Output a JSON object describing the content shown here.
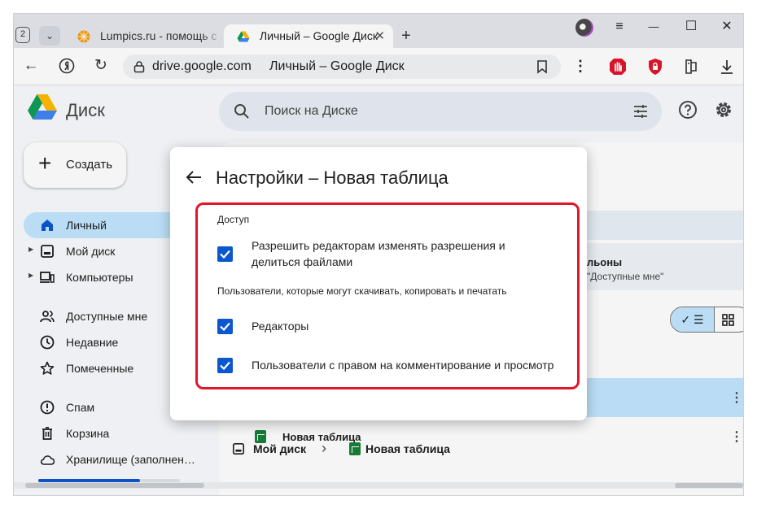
{
  "browser": {
    "tab_count": "2",
    "tabs": [
      {
        "label": "Lumpics.ru - помощь с ко",
        "active": false
      },
      {
        "label": "Личный – Google Диск",
        "active": true
      }
    ],
    "new_tab": "+",
    "window_controls": {
      "menu": "≡",
      "minimize": "—",
      "maximize": "☐",
      "close": "✕"
    },
    "address": {
      "domain": "drive.google.com",
      "title": "Личный – Google Диск"
    }
  },
  "drive": {
    "app_name": "Диск",
    "search": {
      "placeholder": "Поиск на Диске"
    },
    "create_label": "Создать",
    "nav": [
      {
        "label": "Личный",
        "icon": "home-icon",
        "active": true
      },
      {
        "label": "Мой диск",
        "icon": "my-drive-icon"
      },
      {
        "label": "Компьютеры",
        "icon": "computers-icon"
      },
      {
        "label": "Доступные мне",
        "icon": "shared-icon"
      },
      {
        "label": "Недавние",
        "icon": "clock-icon"
      },
      {
        "label": "Помеченные",
        "icon": "star-icon"
      },
      {
        "label": "Спам",
        "icon": "spam-icon"
      },
      {
        "label": "Корзина",
        "icon": "trash-icon"
      },
      {
        "label": "Хранилище (заполнен…",
        "icon": "cloud-icon"
      }
    ],
    "storage_fraction": 0.72,
    "suggest": {
      "line1": "льоны",
      "line2": "\"Доступные мне\""
    },
    "files": [
      {
        "name": "",
        "selected": true
      },
      {
        "name": "Новая таблица",
        "selected": false
      }
    ],
    "breadcrumb": {
      "root": "Мой диск",
      "separator": "›",
      "file": "Новая таблица"
    }
  },
  "dialog": {
    "title": "Настройки – Новая таблица",
    "access_label": "Доступ",
    "opt_editors_line1": "Разрешить редакторам изменять разрешения и",
    "opt_editors_line2": "делиться файлами",
    "download_label": "Пользователи, которые могут скачивать, копировать и печатать",
    "opt_editors_download": "Редакторы",
    "opt_commenters": "Пользователи с правом на комментирование и просмотр"
  },
  "colors": {
    "accent": "#0b57d0",
    "highlight": "#e0162b",
    "selected": "#c2e7ff"
  }
}
